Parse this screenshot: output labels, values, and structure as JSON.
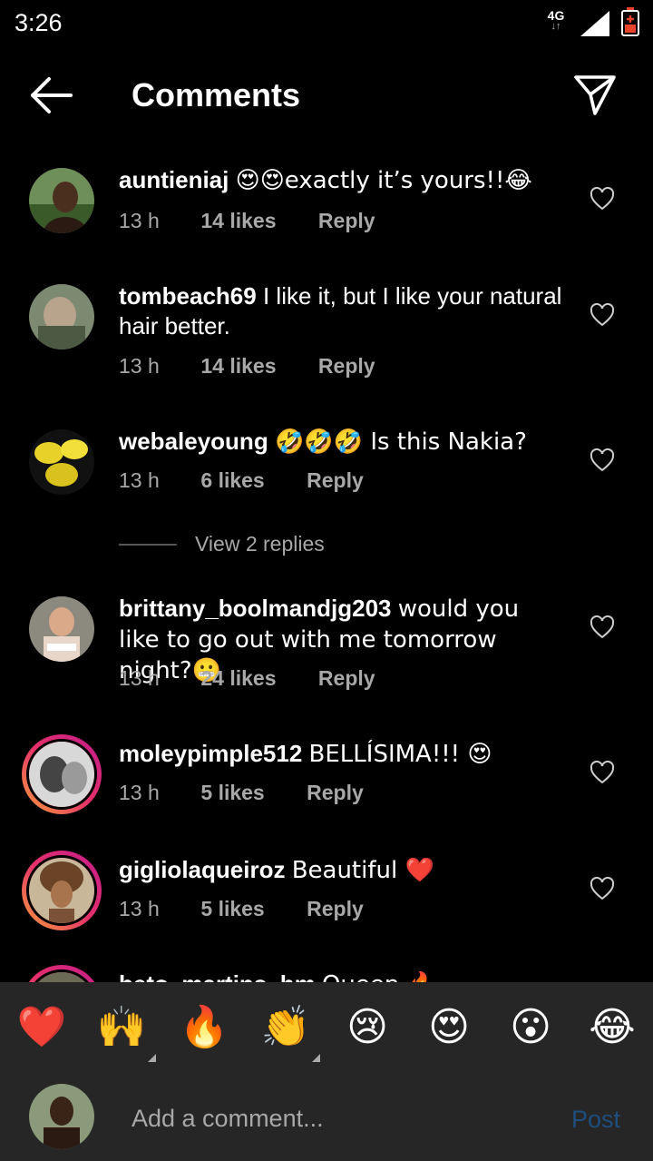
{
  "status_bar": {
    "time": "3:26",
    "network": "4G",
    "network_arrows": "↓↑"
  },
  "header": {
    "title": "Comments",
    "back_icon": "arrow-left-icon",
    "send_icon": "paper-plane-icon"
  },
  "comments": [
    {
      "username": "auntieniaj",
      "text": "😍😍exactly it’s yours!!😂",
      "time": "13 h",
      "likes": "14 likes",
      "reply": "Reply"
    },
    {
      "username": "tombeach69",
      "text": "I like it, but I like your natural hair better.",
      "time": "13 h",
      "likes": "14 likes",
      "reply": "Reply"
    },
    {
      "username": "webaleyoung",
      "text": "🤣🤣🤣 Is this Nakia?",
      "time": "13 h",
      "likes": "6 likes",
      "reply": "Reply"
    },
    {
      "username": "brittany_boolmandjg203",
      "text": "would you like to go out with me tomorrow night?😬",
      "time": "13 h",
      "likes": "24 likes",
      "reply": "Reply"
    },
    {
      "username": "moleypimple512",
      "text": "BELLÍSIMA!!! 😍",
      "time": "13 h",
      "likes": "5 likes",
      "reply": "Reply"
    },
    {
      "username": "gigliolaqueiroz",
      "text": "Beautiful ❤️",
      "time": "13 h",
      "likes": "5 likes",
      "reply": "Reply"
    },
    {
      "username": "beto_martins_hm",
      "text": "Queen 🔥"
    }
  ],
  "view_replies": "View 2 replies",
  "reactions": [
    "❤️",
    "🙌",
    "🔥",
    "👏",
    "😢",
    "😍",
    "😮",
    "😂"
  ],
  "comment_bar": {
    "placeholder": "Add a comment...",
    "post_label": "Post"
  },
  "colors": {
    "background": "#000000",
    "panel": "#262626",
    "muted": "#a8a8a8",
    "post_disabled": "#1e4e7e"
  }
}
